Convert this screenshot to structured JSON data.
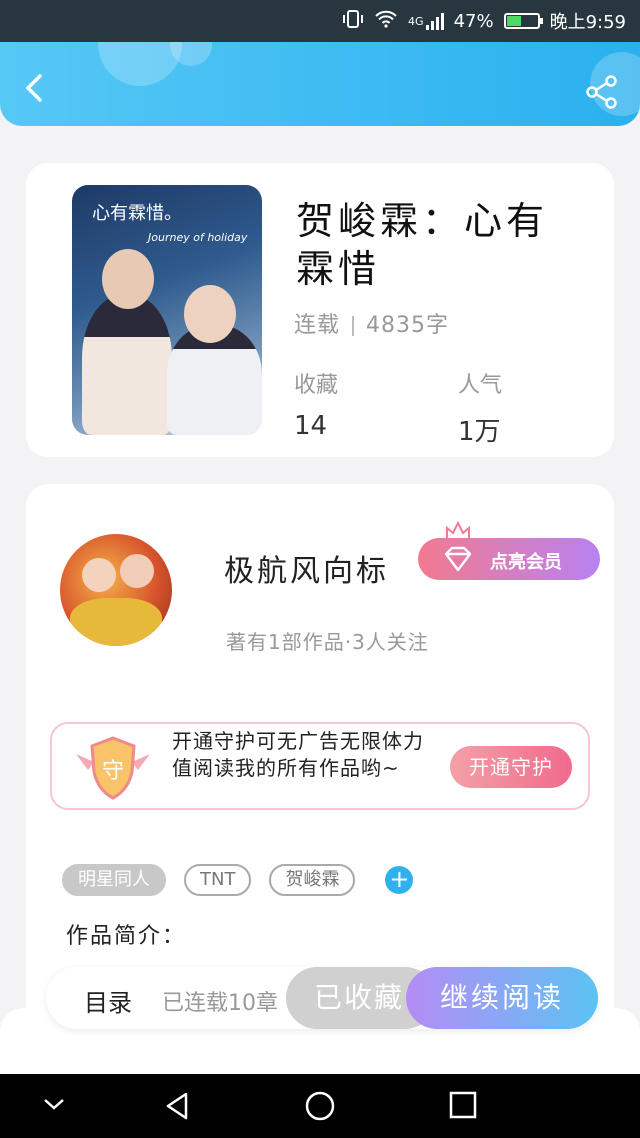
{
  "status_bar": {
    "network": "4G",
    "battery": "47%",
    "time": "晚上9:59"
  },
  "header": {
    "back_icon": "chevron-left-icon",
    "share_icon": "share-icon"
  },
  "book": {
    "title": "贺峻霖：心有霖惜",
    "cover_caption": "心有霖惜。",
    "cover_subtitle": "Journey of holiday",
    "status": "连载",
    "word_count": "4835字",
    "favorites_label": "收藏",
    "favorites_value": "14",
    "popularity_label": "人气",
    "popularity_value": "1万"
  },
  "author": {
    "name": "极航风向标",
    "info": "著有1部作品·3人关注",
    "vip_label": "点亮会员"
  },
  "guard_banner": {
    "shield_char": "守",
    "text": "开通守护可无广告无限体力值阅读我的所有作品哟~",
    "button": "开通守护"
  },
  "tags": [
    "明星同人",
    "TNT",
    "贺峻霖"
  ],
  "intro_label": "作品简介：",
  "action_bar": {
    "toc": "目录",
    "progress": "已连载10章",
    "collected": "已收藏",
    "continue": "继续阅读"
  },
  "colors": {
    "accent": "#2fb1ee",
    "header": "#4bbef3",
    "vip_from": "#f27a90",
    "vip_to": "#b882f0"
  }
}
